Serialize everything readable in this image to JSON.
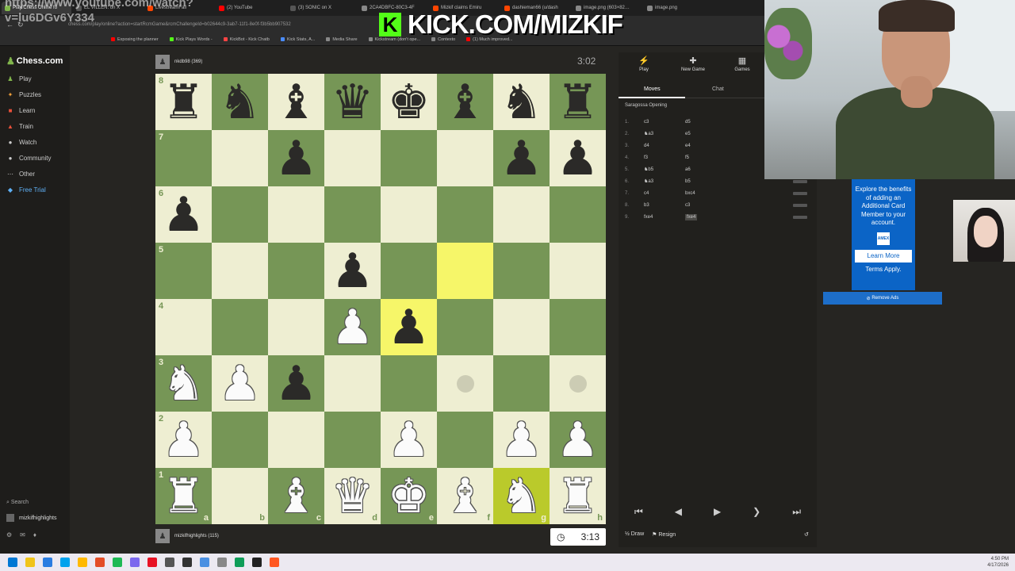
{
  "browser": {
    "tabs": [
      {
        "label": "Play Chess Online fo",
        "color": "#81b64c",
        "active": true
      },
      {
        "label": "EL VILLEN: on X",
        "color": "#555"
      },
      {
        "label": "LivestreamFail",
        "color": "#ff4500"
      },
      {
        "label": "(2) YouTube",
        "color": "#ff0000"
      },
      {
        "label": "(3) SONIC on X",
        "color": "#555"
      },
      {
        "label": "2CA4DBFC-80C3-4F",
        "color": "#888"
      },
      {
        "label": "Mizkif claims Emiru",
        "color": "#ff4500"
      },
      {
        "label": "dashieman66 (u/dash",
        "color": "#ff4500"
      },
      {
        "label": "image.png (603×82…",
        "color": "#888"
      },
      {
        "label": "image.png",
        "color": "#888"
      }
    ],
    "url": "chess.com/play/online?action=startRcmGame&rcmChallengeId=b02644c9-3ab7-11f1-8e0f-f3b5bb907532",
    "overlay_text": "https://www.youtube.com/watch?",
    "overlay_text2": "v=lu6DGv6Y334",
    "bookmarks": [
      {
        "label": "Exposing the planner",
        "color": "#ff0000"
      },
      {
        "label": "Kick Plays Words - ",
        "color": "#53fc18"
      },
      {
        "label": "KickBot - Kick Chatb",
        "color": "#ff4444"
      },
      {
        "label": "Kick Stats, A...",
        "color": "#4a8cff"
      },
      {
        "label": "Media Share",
        "color": "#888"
      },
      {
        "label": "Kickstream (don't ope...",
        "color": "#888"
      },
      {
        "label": "Contexto",
        "color": "#888"
      },
      {
        "label": "(1) Much improved...",
        "color": "#ff0000"
      }
    ]
  },
  "kick_overlay": {
    "badge": "K",
    "text": "KICK.COM/MIZKIF"
  },
  "sidebar": {
    "logo": "Chess.com",
    "items": [
      {
        "label": "Play",
        "icon": "play-icon",
        "glyph": "♟",
        "color": "#81b64c"
      },
      {
        "label": "Puzzles",
        "icon": "puzzle-icon",
        "glyph": "✦",
        "color": "#f7a23b"
      },
      {
        "label": "Learn",
        "icon": "learn-icon",
        "glyph": "■",
        "color": "#e8503a"
      },
      {
        "label": "Train",
        "icon": "train-icon",
        "glyph": "▲",
        "color": "#e8503a"
      },
      {
        "label": "Watch",
        "icon": "watch-icon",
        "glyph": "●",
        "color": "#ccc"
      },
      {
        "label": "Community",
        "icon": "community-icon",
        "glyph": "●",
        "color": "#ccc"
      },
      {
        "label": "Other",
        "icon": "other-icon",
        "glyph": "⋯",
        "color": "#ccc"
      },
      {
        "label": "Free Trial",
        "icon": "diamond-icon",
        "glyph": "◆",
        "color": "#5fb0f5"
      }
    ],
    "search": "Search",
    "username": "mizkifhighlights"
  },
  "game": {
    "top_player": {
      "name": "nkdb98",
      "rating": "(369)"
    },
    "bottom_player": {
      "name": "mizkifhighlights",
      "rating": "(115)"
    },
    "top_clock": "3:02",
    "bottom_clock": "3:13",
    "board": [
      [
        "br",
        "bn",
        "bb",
        "bq",
        "bk",
        "bb",
        "bn",
        "br"
      ],
      [
        "",
        "",
        "bp",
        "",
        "",
        "",
        "bp",
        "bp"
      ],
      [
        "bp",
        "",
        "",
        "",
        "",
        "",
        "",
        ""
      ],
      [
        "",
        "",
        "",
        "bp",
        "",
        "",
        "",
        ""
      ],
      [
        "",
        "",
        "",
        "wp",
        "bp",
        "",
        "",
        ""
      ],
      [
        "wn",
        "wp",
        "bp",
        "",
        "",
        "",
        "",
        ""
      ],
      [
        "wp",
        "",
        "",
        "",
        "wp",
        "",
        "wp",
        "wp"
      ],
      [
        "wr",
        "",
        "wb",
        "wq",
        "wk",
        "wb",
        "wn",
        "wr"
      ]
    ],
    "highlights": [
      [
        3,
        5
      ],
      [
        4,
        4
      ]
    ],
    "highlights_dark": [
      [
        7,
        6
      ]
    ],
    "hints": [
      [
        5,
        5
      ],
      [
        5,
        7
      ]
    ],
    "ranks": [
      "8",
      "7",
      "6",
      "5",
      "4",
      "3",
      "2",
      "1"
    ],
    "files": [
      "a",
      "b",
      "c",
      "d",
      "e",
      "f",
      "g",
      "h"
    ]
  },
  "panel": {
    "tabs": [
      {
        "label": "Play",
        "glyph": "⚡"
      },
      {
        "label": "New Game",
        "glyph": "✚"
      },
      {
        "label": "Games",
        "glyph": "▦"
      }
    ],
    "subtabs": {
      "moves": "Moves",
      "chat": "Chat"
    },
    "opening": "Saragossa Opening",
    "moves": [
      {
        "n": "1.",
        "w": "c3",
        "b": "d5"
      },
      {
        "n": "2.",
        "w": "♞a3",
        "b": "e5"
      },
      {
        "n": "3.",
        "w": "d4",
        "b": "e4"
      },
      {
        "n": "4.",
        "w": "f3",
        "b": "f5"
      },
      {
        "n": "5.",
        "w": "♞b5",
        "b": "a6"
      },
      {
        "n": "6.",
        "w": "♞a3",
        "b": "b5"
      },
      {
        "n": "7.",
        "w": "c4",
        "b": "bxc4"
      },
      {
        "n": "8.",
        "w": "b3",
        "b": "c3"
      },
      {
        "n": "9.",
        "w": "fxe4",
        "b": "fxe4"
      }
    ],
    "nav": [
      "⏮",
      "◀",
      "▶",
      "❯",
      "⏭"
    ],
    "draw": "Draw",
    "resign": "Resign"
  },
  "ad": {
    "text": "Explore the benefits of adding an Additional Card Member to your account.",
    "badge": "AMEX",
    "cta": "Learn More",
    "terms": "Terms Apply.",
    "remove": "Remove Ads"
  },
  "taskbar": {
    "time": "4:50 PM",
    "date": "4/17/2026"
  }
}
